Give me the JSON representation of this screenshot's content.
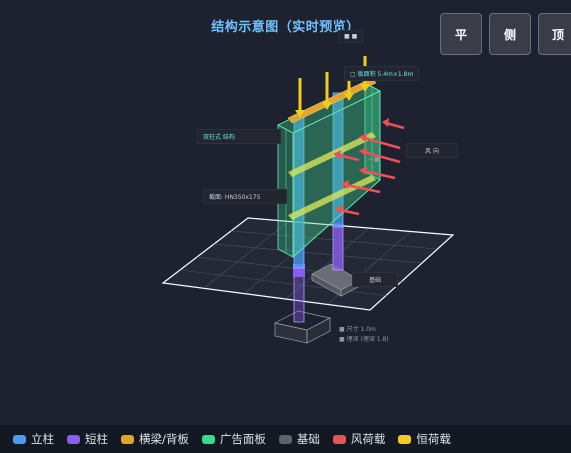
{
  "header": {
    "title": "结构示意图（实时预览）"
  },
  "view_buttons": {
    "front": "平",
    "side": "侧",
    "top": "顶"
  },
  "annotations": {
    "top_cap": "■ ■",
    "beam_depth": "□ 板面积 5.4m×1.8m",
    "structure": "双柱式 结构",
    "section": "截面: HN350x175",
    "wind": "风 向",
    "wind_arrow": "→ ■",
    "base": "基础",
    "base_dims_1": "■ 尺寸 1.0m",
    "base_dims_2": "■ 埋深 (埋深 1.8)"
  },
  "legend": [
    {
      "label": "立柱",
      "color": "#4b9cf5"
    },
    {
      "label": "短柱",
      "color": "#8b5cf0"
    },
    {
      "label": "横梁/背板",
      "color": "#e0a531"
    },
    {
      "label": "广告面板",
      "color": "#3fd68d"
    },
    {
      "label": "基础",
      "color": "#5f626b"
    },
    {
      "label": "风荷载",
      "color": "#ef4f57"
    },
    {
      "label": "恒荷载",
      "color": "#f0cd1c"
    }
  ]
}
